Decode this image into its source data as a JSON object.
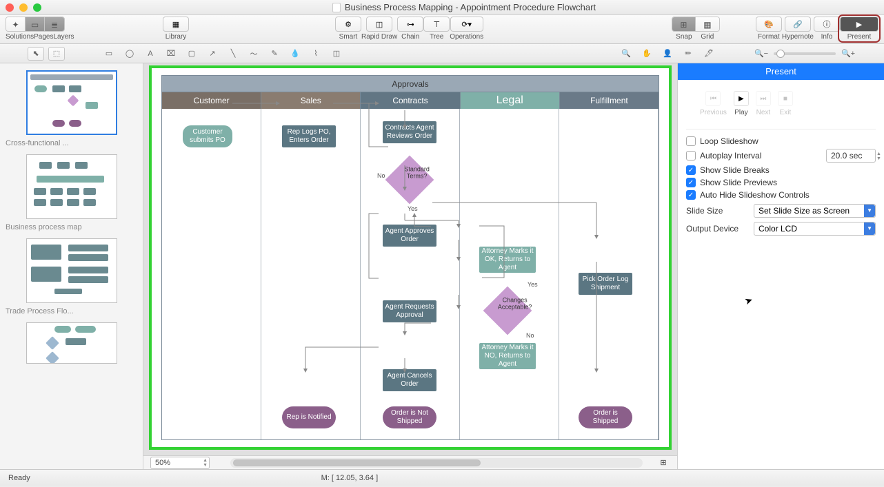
{
  "title": "Business Process Mapping - Appointment Procedure Flowchart",
  "toolbar": {
    "group1": {
      "labels": [
        "Solutions",
        "Pages",
        "Layers"
      ]
    },
    "library": "Library",
    "smart": "Smart",
    "rapid": "Rapid Draw",
    "chain": "Chain",
    "tree": "Tree",
    "operations": "Operations",
    "snap": "Snap",
    "grid": "Grid",
    "format": "Format",
    "hypernote": "Hypernote",
    "info": "Info",
    "present": "Present"
  },
  "thumbs": [
    {
      "label": "Cross-functional ..."
    },
    {
      "label": "Business process map"
    },
    {
      "label": "Trade Process Flo..."
    },
    {
      "label": ""
    }
  ],
  "diagram": {
    "title": "Approvals",
    "lanes": [
      "Customer",
      "Sales",
      "Contracts",
      "Legal",
      "Fulfillment"
    ],
    "nodes": {
      "customer_po": "Customer submits PO",
      "rep_logs": "Rep Logs PO, Enters Order",
      "agent_reviews": "Contracts Agent Reviews Order",
      "std_terms": "Standard Terms?",
      "agent_approves": "Agent Approves Order",
      "attorney_ok": "Attorney Marks it OK, Returns to Agent",
      "changes": "Changes Acceptable?",
      "attorney_no": "Attorney Marks it NO, Returns to Agent",
      "agent_requests": "Agent Requests Approval",
      "agent_cancels": "Agent Cancels Order",
      "pick_order": "Pick Order Log Shipment",
      "rep_notified": "Rep is Notified",
      "not_shipped": "Order is Not Shipped",
      "shipped": "Order is Shipped",
      "no": "No",
      "yes": "Yes",
      "yes2": "Yes",
      "no2": "No"
    }
  },
  "present": {
    "title": "Present",
    "previous": "Previous",
    "play": "Play",
    "next": "Next",
    "exit": "Exit",
    "loop": "Loop Slideshow",
    "autoplay": "Autoplay Interval",
    "autoplay_val": "20.0 sec",
    "breaks": "Show Slide Breaks",
    "previews": "Show Slide Previews",
    "autohide": "Auto Hide Slideshow Controls",
    "slide_size_lbl": "Slide Size",
    "slide_size": "Set Slide Size as Screen",
    "output_lbl": "Output Device",
    "output": "Color LCD"
  },
  "status": {
    "ready": "Ready",
    "zoom": "50%",
    "mouse": "M: [ 12.05, 3.64 ]"
  }
}
